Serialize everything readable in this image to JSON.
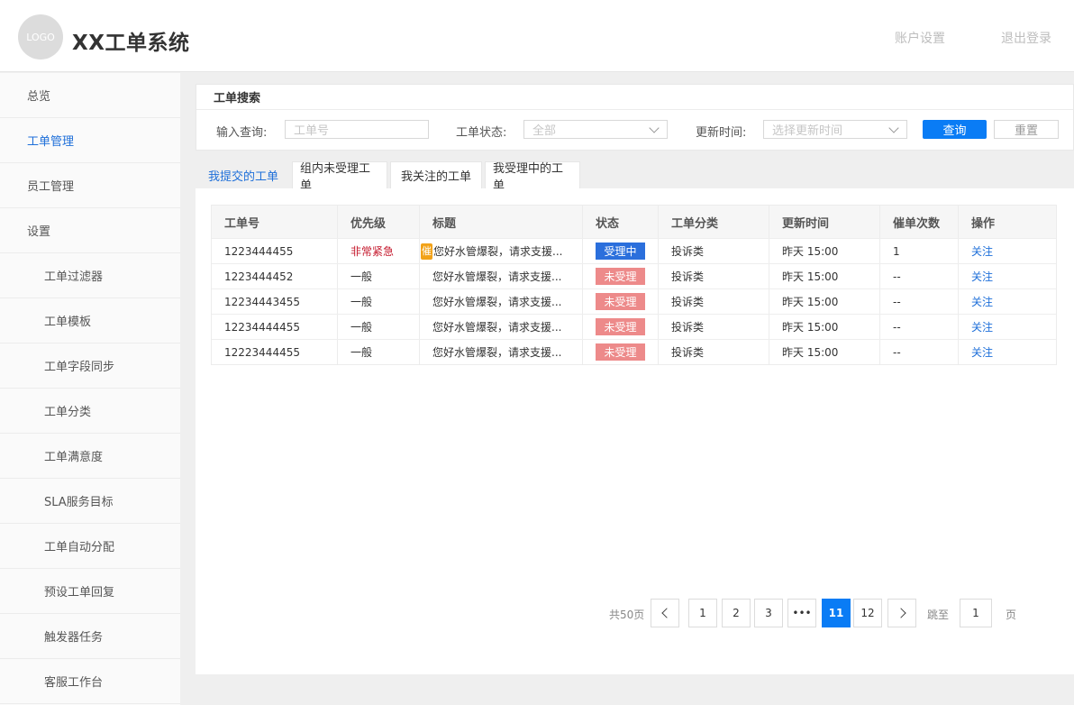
{
  "header": {
    "logo": "LOGO",
    "title": "XX工单系统",
    "account_settings": "账户设置",
    "logout": "退出登录"
  },
  "sidebar": {
    "items": [
      {
        "label": "总览"
      },
      {
        "label": "工单管理"
      },
      {
        "label": "员工管理"
      },
      {
        "label": "设置"
      },
      {
        "label": "工单过滤器"
      },
      {
        "label": "工单模板"
      },
      {
        "label": "工单字段同步"
      },
      {
        "label": "工单分类"
      },
      {
        "label": "工单满意度"
      },
      {
        "label": "SLA服务目标"
      },
      {
        "label": "工单自动分配"
      },
      {
        "label": "预设工单回复"
      },
      {
        "label": "触发器任务"
      },
      {
        "label": "客服工作台"
      }
    ]
  },
  "search": {
    "title": "工单搜索",
    "query_label": "输入查询:",
    "query_placeholder": "工单号",
    "status_label": "工单状态:",
    "status_value": "全部",
    "time_label": "更新时间:",
    "time_placeholder": "选择更新时间",
    "query_button": "查询",
    "reset_button": "重置"
  },
  "tabs": [
    {
      "label": "我提交的工单"
    },
    {
      "label": "组内未受理工单"
    },
    {
      "label": "我关注的工单"
    },
    {
      "label": "我受理中的工单"
    }
  ],
  "table": {
    "headers": [
      "工单号",
      "优先级",
      "标题",
      "状态",
      "工单分类",
      "更新时间",
      "催单次数",
      "操作"
    ],
    "rows": [
      {
        "id": "1223444455",
        "priority": "非常紧急",
        "badge": "催",
        "title": "您好水管爆裂，请求支援...",
        "status": "受理中",
        "category": "投诉类",
        "updated": "昨天 15:00",
        "reminders": "1",
        "action": "关注"
      },
      {
        "id": "1223444452",
        "priority": "一般",
        "badge": "",
        "title": "您好水管爆裂，请求支援...",
        "status": "未受理",
        "category": "投诉类",
        "updated": "昨天 15:00",
        "reminders": "--",
        "action": "关注"
      },
      {
        "id": "12234443455",
        "priority": "一般",
        "badge": "",
        "title": "您好水管爆裂，请求支援...",
        "status": "未受理",
        "category": "投诉类",
        "updated": "昨天 15:00",
        "reminders": "--",
        "action": "关注"
      },
      {
        "id": "12234444455",
        "priority": "一般",
        "badge": "",
        "title": "您好水管爆裂，请求支援...",
        "status": "未受理",
        "category": "投诉类",
        "updated": "昨天 15:00",
        "reminders": "--",
        "action": "关注"
      },
      {
        "id": "12223444455",
        "priority": "一般",
        "badge": "",
        "title": "您好水管爆裂，请求支援...",
        "status": "未受理",
        "category": "投诉类",
        "updated": "昨天 15:00",
        "reminders": "--",
        "action": "关注"
      }
    ]
  },
  "pagination": {
    "total": "共50页",
    "pages": [
      "1",
      "2",
      "3",
      "•••",
      "11",
      "12"
    ],
    "current": "11",
    "goto_label": "跳至",
    "goto_value": "1",
    "page_suffix": "页"
  },
  "colors": {
    "primary": "#0a7cf5",
    "link": "#1e6fd9",
    "urgent": "#c4172b",
    "processing": "#2b6fdc",
    "unaccepted": "#ed8a8a",
    "reminder_badge": "#f2a218"
  }
}
